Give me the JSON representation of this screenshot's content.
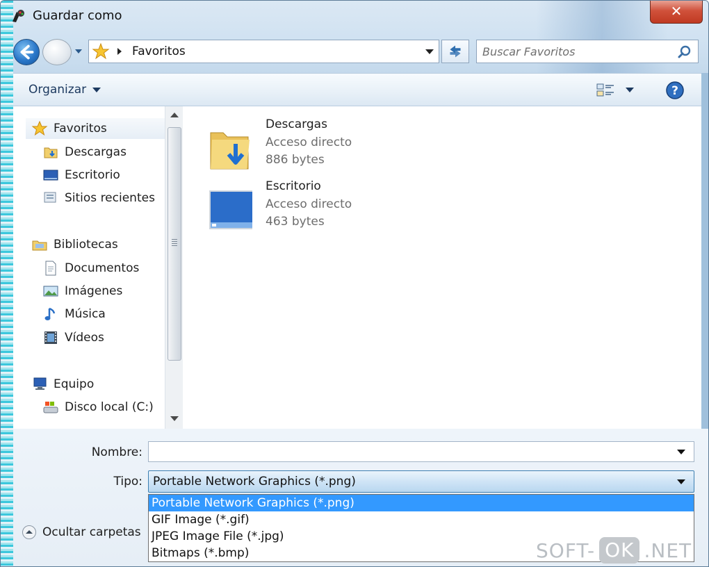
{
  "window": {
    "title": "Guardar como",
    "close_label": "✕"
  },
  "address": {
    "location": "Favoritos"
  },
  "search": {
    "placeholder": "Buscar Favoritos"
  },
  "toolbar": {
    "organize_label": "Organizar"
  },
  "navigation": {
    "groups": [
      {
        "label": "Favoritos",
        "icon": "star-icon",
        "items": [
          {
            "label": "Descargas",
            "icon": "downloads-folder-icon"
          },
          {
            "label": "Escritorio",
            "icon": "desktop-icon"
          },
          {
            "label": "Sitios recientes",
            "icon": "recent-places-icon"
          }
        ]
      },
      {
        "label": "Bibliotecas",
        "icon": "libraries-icon",
        "items": [
          {
            "label": "Documentos",
            "icon": "documents-icon"
          },
          {
            "label": "Imágenes",
            "icon": "pictures-icon"
          },
          {
            "label": "Música",
            "icon": "music-icon"
          },
          {
            "label": "Vídeos",
            "icon": "videos-icon"
          }
        ]
      },
      {
        "label": "Equipo",
        "icon": "computer-icon",
        "items": [
          {
            "label": "Disco local (C:)",
            "icon": "local-disk-icon"
          }
        ]
      }
    ]
  },
  "files": [
    {
      "name": "Descargas",
      "type": "Acceso directo",
      "size": "886 bytes",
      "icon": "downloads-folder-icon"
    },
    {
      "name": "Escritorio",
      "type": "Acceso directo",
      "size": "463 bytes",
      "icon": "desktop-icon"
    }
  ],
  "form": {
    "name_label": "Nombre:",
    "name_value": "",
    "type_label": "Tipo:",
    "type_value": "Portable Network Graphics (*.png)",
    "type_options": [
      "Portable Network Graphics (*.png)",
      "GIF Image (*.gif)",
      "JPEG Image File (*.jpg)",
      "Bitmaps (*.bmp)"
    ],
    "selected_option_index": 0
  },
  "footer": {
    "hide_folders_label": "Ocultar carpetas"
  },
  "watermark": {
    "left": "SOFT-",
    "pill": "OK",
    "right": ".NET"
  },
  "colors": {
    "selection": "#3399ff",
    "close_button": "#c03a22",
    "accent": "#2a77c9"
  }
}
